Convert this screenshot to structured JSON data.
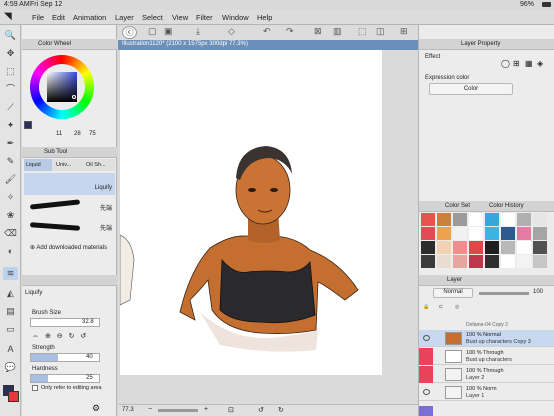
{
  "status": {
    "time": "4:59 AM",
    "date": "Fri Sep 12",
    "battery": "96%"
  },
  "menu": {
    "items": [
      "File",
      "Edit",
      "Animation",
      "Layer",
      "Select",
      "View",
      "Filter",
      "Window",
      "Help"
    ]
  },
  "document": {
    "tab_title": "Illustration1120* (2100 x 1575px 300dpi 77.3%)",
    "zoom": "77.3"
  },
  "color_wheel": {
    "title": "Color Wheel",
    "hsv_values": [
      "11",
      "28",
      "75"
    ],
    "main_color": "#2b2f5a",
    "sub_color": "#e03a3a"
  },
  "sub_tool": {
    "title": "Sub Tool",
    "tabs": [
      "Liquid",
      "Univ...",
      "Oil Sh..."
    ],
    "brushes": [
      {
        "name": "Liquify"
      },
      {
        "name": "先端"
      },
      {
        "name": "先端"
      }
    ],
    "add_materials_label": "Add downloaded materials"
  },
  "tool_property": {
    "tool_name": "Liquify",
    "brush_size_label": "Brush Size",
    "brush_size_value": "32.8",
    "strength_label": "Strength",
    "strength_value": "40",
    "strength_fraction": 0.4,
    "hardness_label": "Hardness",
    "hardness_value": "25",
    "hardness_fraction": 0.25,
    "refer_label": "Only refer to editing area"
  },
  "layer_property": {
    "title": "Layer Property",
    "effect_label": "Effect",
    "expression_label": "Expression color",
    "expression_value": "Color"
  },
  "color_history": {
    "tabs": [
      "Color Set",
      "Color History"
    ],
    "swatches": [
      "#e8534e",
      "#c9813c",
      "#9b9b9b",
      "#ffffff",
      "#37a6d9",
      "#ffffff",
      "#b0b0b0",
      "#e6e6e6",
      "#e44a55",
      "#eda24b",
      "#f1f1f1",
      "#ffffff",
      "#3fb3e0",
      "#2d5b8f",
      "#e67aa2",
      "#a5a5a5",
      "#2c2c2c",
      "#f3d2b4",
      "#f18d8d",
      "#e04747",
      "#1f1f1f",
      "#b8b8b8",
      "#ffffff",
      "#515151",
      "#3b3b3b",
      "#eadcd0",
      "#e6a6a0",
      "#c0364a",
      "#2f2f2f",
      "#ffffff",
      "#f3f3f3",
      "#c6c6c6"
    ]
  },
  "layers": {
    "title": "Layer",
    "blend_mode": "Normal",
    "opacity": "100",
    "top_partial": "Defame-04 Copy 2",
    "rows": [
      {
        "line1": "100 % Normal",
        "line2": "Bust up characters Copy 3",
        "selected": true
      },
      {
        "line1": "100 % Through",
        "line2": "Bust up characters",
        "selected": false
      },
      {
        "line1": "100 % Through",
        "line2": "Layer 2",
        "selected": false
      },
      {
        "line1": "100 % Norm",
        "line2": "Layer 1",
        "selected": false
      }
    ]
  },
  "bottom": {
    "zoom": "77.3"
  }
}
